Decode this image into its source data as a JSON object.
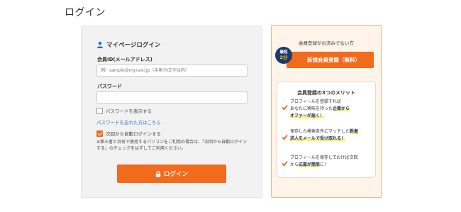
{
  "page": {
    "title": "ログイン"
  },
  "login": {
    "heading": "マイページログイン",
    "email_label": "会員ID(メールアドレス)",
    "email_placeholder": "例）sample@mynavi.jp（半角70文字以内）",
    "password_label": "パスワード",
    "password_value": "",
    "show_password_label": "パスワードを表示する",
    "forgot_link": "パスワードを忘れた方はこちら",
    "auto_login_label": "次回から自動ログインする",
    "auto_login_checked": true,
    "note": "※第三者と共有で使用するパソコンをご利用の場合は、「次回から自動ログインする」のチェックをはずしてご利用ください。",
    "button_label": "ログイン"
  },
  "register": {
    "title": "会員登録がお済みでない方",
    "badge_top": "最短",
    "badge_bottom": "2分",
    "button_label": "新規会員登録（無料）",
    "merits_title": "会員登録の3つのメリット",
    "merits": [
      {
        "pre": "プロフィールを登録すれば\nあなたに興味を持った",
        "hl": "企業から\nオファーが届く！",
        "post": ""
      },
      {
        "pre": "保存した検索条件にマッチした",
        "hl": "新着\n求人をメールで受け取れる！",
        "post": ""
      },
      {
        "pre": "プロフィールを保存しておけば次回\nから",
        "hl": "応募が簡単",
        "post": "に！"
      }
    ]
  },
  "colors": {
    "accent": "#f26a1b",
    "navy": "#1c3a6e",
    "link": "#2a72c4",
    "highlight": "#fff176"
  }
}
